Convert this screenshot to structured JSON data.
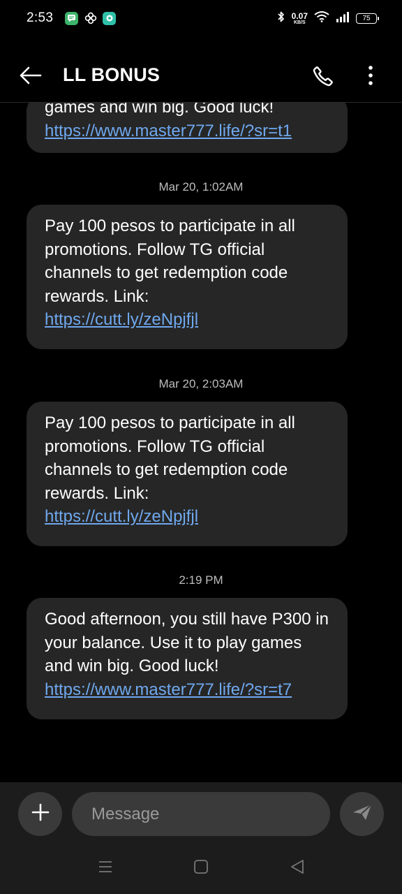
{
  "status_bar": {
    "time": "2:53",
    "net_speed_value": "0.07",
    "net_speed_unit": "KB/S",
    "battery": "75",
    "notification_icons": [
      "messages-icon",
      "fan-icon",
      "chat-icon"
    ],
    "system_icons": [
      "bluetooth-icon",
      "wifi-icon",
      "signal-icon",
      "battery-icon"
    ]
  },
  "app_bar": {
    "title": "LL BONUS",
    "icons": [
      "back-arrow-icon",
      "phone-icon",
      "more-vert-icon"
    ]
  },
  "messages": [
    {
      "text": "games and win big. Good luck!",
      "link": "https://www.master777.life/?sr=t1"
    },
    {
      "timestamp": "Mar 20, 1:02AM",
      "text": "Pay 100 pesos to participate in all promotions. Follow TG official channels to get redemption code rewards. Link:",
      "link": "https://cutt.ly/zeNpjfjl"
    },
    {
      "timestamp": "Mar 20, 2:03AM",
      "text": "Pay 100 pesos to participate in all promotions. Follow TG official channels to get redemption code rewards. Link:",
      "link": "https://cutt.ly/zeNpjfjl"
    },
    {
      "timestamp": "2:19 PM",
      "text": "Good afternoon, you still have P300 in your balance. Use it to play games and win big. Good luck!",
      "link": "https://www.master777.life/?sr=t7"
    }
  ],
  "composer": {
    "placeholder": "Message",
    "icons": [
      "add-icon",
      "send-icon"
    ]
  },
  "nav_bar": {
    "icons": [
      "recents-icon",
      "home-icon",
      "back-icon"
    ]
  },
  "colors": {
    "background": "#000000",
    "bubble": "#262626",
    "link": "#6fa8ee",
    "timestamp": "#bdbdbd",
    "composer_bg": "#1c1c1c"
  }
}
